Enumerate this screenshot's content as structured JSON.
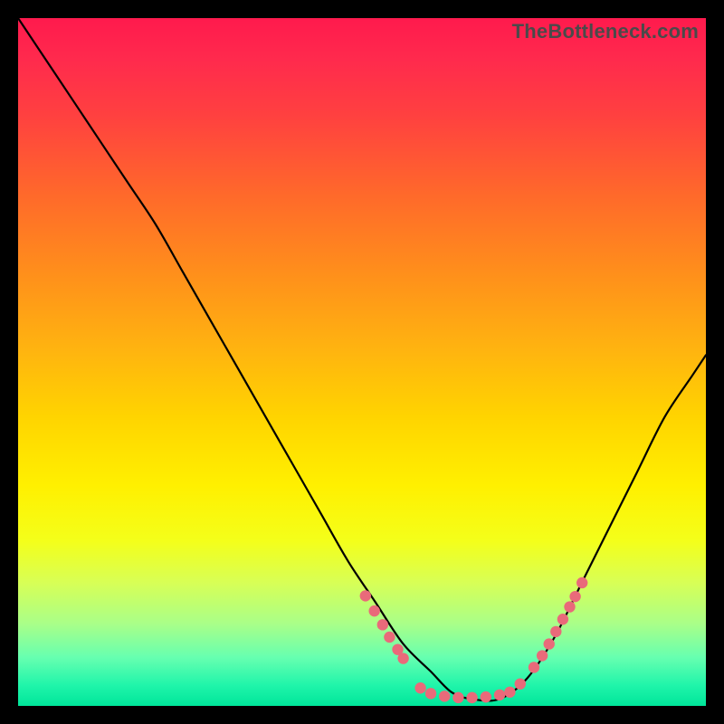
{
  "watermark": {
    "text": "TheBottleneck.com"
  },
  "colors": {
    "curve_stroke": "#000000",
    "dot_fill": "#e96a7a",
    "background": "#000000"
  },
  "chart_data": {
    "type": "line",
    "title": "",
    "xlabel": "",
    "ylabel": "",
    "xlim": [
      0,
      100
    ],
    "ylim": [
      0,
      100
    ],
    "series": [
      {
        "name": "bottleneck-curve",
        "x": [
          0,
          4,
          8,
          12,
          16,
          20,
          24,
          28,
          32,
          36,
          40,
          44,
          48,
          52,
          56,
          60,
          63,
          66,
          70,
          74,
          78,
          82,
          86,
          90,
          94,
          98,
          100
        ],
        "y": [
          100,
          94,
          88,
          82,
          76,
          70,
          63,
          56,
          49,
          42,
          35,
          28,
          21,
          15,
          9,
          5,
          2,
          1,
          1,
          4,
          10,
          18,
          26,
          34,
          42,
          48,
          51
        ]
      }
    ],
    "dots": {
      "name": "highlight-points",
      "points": [
        {
          "x": 50.5,
          "y": 16.0
        },
        {
          "x": 51.8,
          "y": 13.8
        },
        {
          "x": 53.0,
          "y": 11.8
        },
        {
          "x": 54.0,
          "y": 10.0
        },
        {
          "x": 55.2,
          "y": 8.2
        },
        {
          "x": 56.0,
          "y": 6.9
        },
        {
          "x": 58.5,
          "y": 2.6
        },
        {
          "x": 60.0,
          "y": 1.8
        },
        {
          "x": 62.0,
          "y": 1.4
        },
        {
          "x": 64.0,
          "y": 1.2
        },
        {
          "x": 66.0,
          "y": 1.2
        },
        {
          "x": 68.0,
          "y": 1.3
        },
        {
          "x": 70.0,
          "y": 1.6
        },
        {
          "x": 71.5,
          "y": 2.0
        },
        {
          "x": 73.0,
          "y": 3.2
        },
        {
          "x": 75.0,
          "y": 5.6
        },
        {
          "x": 76.2,
          "y": 7.3
        },
        {
          "x": 77.2,
          "y": 9.0
        },
        {
          "x": 78.2,
          "y": 10.8
        },
        {
          "x": 79.2,
          "y": 12.6
        },
        {
          "x": 80.2,
          "y": 14.4
        },
        {
          "x": 81.0,
          "y": 15.9
        },
        {
          "x": 82.0,
          "y": 17.9
        }
      ]
    }
  }
}
